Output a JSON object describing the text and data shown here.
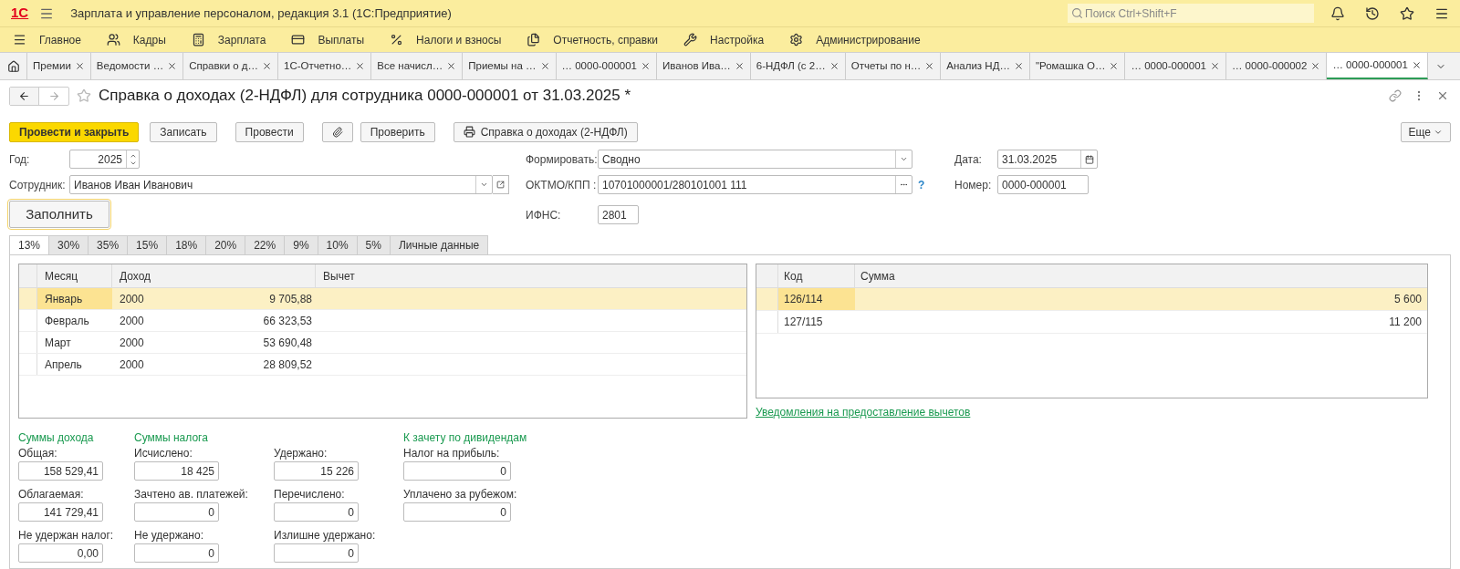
{
  "app": {
    "logo": "1С",
    "title": "Зарплата и управление персоналом, редакция 3.1  (1С:Предприятие)",
    "search_placeholder": "Поиск Ctrl+Shift+F"
  },
  "sections": [
    {
      "label": "Главное"
    },
    {
      "label": "Кадры"
    },
    {
      "label": "Зарплата"
    },
    {
      "label": "Выплаты"
    },
    {
      "label": "Налоги и взносы"
    },
    {
      "label": "Отчетность, справки"
    },
    {
      "label": "Настройка"
    },
    {
      "label": "Администрирование"
    }
  ],
  "open_tabs": [
    {
      "label": "Премии",
      "selected": false
    },
    {
      "label": "Ведомости …",
      "selected": false
    },
    {
      "label": "Справки о д…",
      "selected": false
    },
    {
      "label": "1С-Отчетно…",
      "selected": false
    },
    {
      "label": "Все начисл…",
      "selected": false
    },
    {
      "label": "Приемы на …",
      "selected": false
    },
    {
      "label": "… 0000-000001",
      "selected": false
    },
    {
      "label": "Иванов Ива…",
      "selected": false
    },
    {
      "label": "6-НДФЛ (с 2…",
      "selected": false
    },
    {
      "label": "Отчеты по н…",
      "selected": false
    },
    {
      "label": "Анализ НД…",
      "selected": false
    },
    {
      "label": "\"Ромашка О…",
      "selected": false
    },
    {
      "label": "… 0000-000001",
      "selected": false
    },
    {
      "label": "… 0000-000002",
      "selected": false
    },
    {
      "label": "… 0000-000001",
      "selected": true
    }
  ],
  "form": {
    "title": "Справка о доходах (2-НДФЛ) для сотрудника 0000-000001 от 31.03.2025 *",
    "buttons": [
      {
        "label": "Провести и закрыть",
        "kind": "primary"
      },
      {
        "label": "Записать",
        "kind": "plain"
      },
      {
        "label": "Провести",
        "kind": "plain"
      },
      {
        "kind": "attach"
      },
      {
        "label": "Проверить",
        "kind": "plain"
      },
      {
        "label": "Справка о доходах (2-НДФЛ)",
        "kind": "print"
      }
    ],
    "more": "Еще",
    "year": {
      "label": "Год:",
      "value": "2025"
    },
    "employee": {
      "label": "Сотрудник:",
      "value": "Иванов Иван Иванович"
    },
    "fill_button": "Заполнить",
    "mode": {
      "label": "Формировать:",
      "value": "Сводно"
    },
    "oktmo": {
      "label": "ОКТМО/КПП :",
      "value": "10701000001/280101001 111",
      "help": "?"
    },
    "ifns": {
      "label": "ИФНС:",
      "value": "2801"
    },
    "date": {
      "label": "Дата:",
      "value": "31.03.2025"
    },
    "number": {
      "label": "Номер:",
      "value": "0000-000001"
    }
  },
  "rate_tabs": [
    {
      "label": "13%",
      "selected": true
    },
    {
      "label": "30%",
      "selected": false
    },
    {
      "label": "35%",
      "selected": false
    },
    {
      "label": "15%",
      "selected": false
    },
    {
      "label": "18%",
      "selected": false
    },
    {
      "label": "20%",
      "selected": false
    },
    {
      "label": "22%",
      "selected": false
    },
    {
      "label": "9%",
      "selected": false
    },
    {
      "label": "10%",
      "selected": false
    },
    {
      "label": "5%",
      "selected": false
    },
    {
      "label": "Личные данные",
      "selected": false
    }
  ],
  "income_table": {
    "columns": [
      "Месяц",
      "Доход",
      "Вычет"
    ],
    "rows": [
      {
        "month": "Январь",
        "code": "2000",
        "amount": "9 705,88",
        "selected": true
      },
      {
        "month": "Февраль",
        "code": "2000",
        "amount": "66 323,53",
        "selected": false
      },
      {
        "month": "Март",
        "code": "2000",
        "amount": "53 690,48",
        "selected": false
      },
      {
        "month": "Апрель",
        "code": "2000",
        "amount": "28 809,52",
        "selected": false
      }
    ]
  },
  "deductions_table": {
    "columns": [
      "Код",
      "Сумма"
    ],
    "rows": [
      {
        "code": "126/114",
        "sum": "5 600",
        "selected": true
      },
      {
        "code": "127/115",
        "sum": "11 200",
        "selected": false
      }
    ]
  },
  "notices_link": "Уведомления на предоставление вычетов",
  "totals": [
    {
      "heading": "Суммы дохода",
      "fields": [
        {
          "label": "Общая:",
          "value": "158 529,41"
        },
        {
          "label": "Облагаемая:",
          "value": "141 729,41"
        },
        {
          "label": "Не удержан налог:",
          "value": "0,00"
        }
      ]
    },
    {
      "heading": "Суммы налога",
      "fields": [
        {
          "label": "Исчислено:",
          "value": "18 425"
        },
        {
          "label": "Зачтено ав. платежей:",
          "value": "0"
        },
        {
          "label": "Не удержано:",
          "value": "0"
        }
      ]
    },
    {
      "fields": [
        {
          "label": "Удержано:",
          "value": "15 226"
        },
        {
          "label": "Перечислено:",
          "value": "0"
        },
        {
          "label": "Излишне удержано:",
          "value": "0"
        }
      ]
    },
    {
      "heading": "К зачету по дивидендам",
      "fields": [
        {
          "label": "Налог на прибыль:",
          "value": "0"
        },
        {
          "label": "Уплачено за рубежом:",
          "value": "0"
        }
      ]
    }
  ]
}
